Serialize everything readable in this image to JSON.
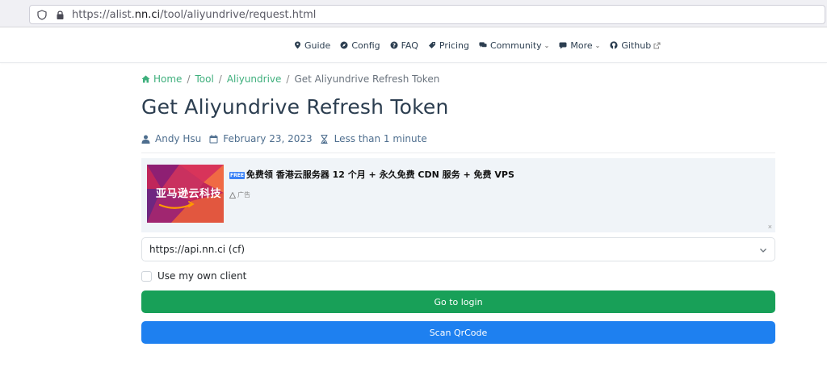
{
  "browser": {
    "url_prefix": "https://alist.",
    "url_host": "nn.ci",
    "url_path": "/tool/aliyundrive/request.html"
  },
  "nav": {
    "items": [
      {
        "label": "Guide",
        "icon": "map-marker-icon"
      },
      {
        "label": "Config",
        "icon": "compass-icon"
      },
      {
        "label": "FAQ",
        "icon": "question-circle-icon"
      },
      {
        "label": "Pricing",
        "icon": "tag-icon"
      },
      {
        "label": "Community",
        "icon": "comments-icon",
        "dropdown": true
      },
      {
        "label": "More",
        "icon": "message-icon",
        "dropdown": true
      },
      {
        "label": "Github",
        "icon": "github-icon",
        "external": true
      }
    ]
  },
  "breadcrumb": {
    "items": [
      "Home",
      "Tool",
      "Aliyundrive"
    ],
    "current": "Get Aliyundrive Refresh Token",
    "separator": "/"
  },
  "page": {
    "title": "Get Aliyundrive Refresh Token"
  },
  "meta": {
    "author": "Andy Hsu",
    "date": "February 23, 2023",
    "reading_time": "Less than 1 minute"
  },
  "ad": {
    "image_text": "亚马逊云科技",
    "free_badge": "FREE",
    "title": "免费领 香港云服务器 12 个月 + 永久免费 CDN 服务 + 免费 VPS",
    "label": "广告",
    "close": "×"
  },
  "form": {
    "select_value": "https://api.nn.ci (cf)",
    "checkbox_label": "Use my own client",
    "login_button": "Go to login",
    "qrcode_button": "Scan QrCode"
  },
  "colors": {
    "accent": "#3eaf7c",
    "login_button": "#18a058",
    "qrcode_button": "#1e80f0"
  }
}
